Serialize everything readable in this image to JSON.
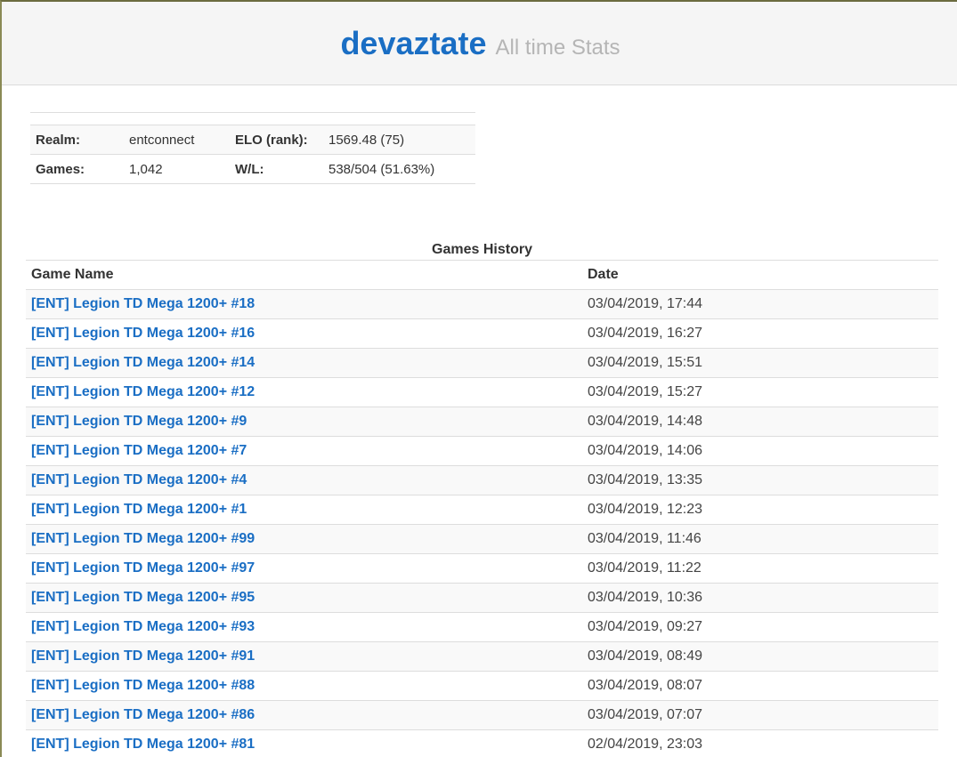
{
  "header": {
    "player_name": "devaztate",
    "subtitle": "All time Stats"
  },
  "stats": {
    "realm_label": "Realm:",
    "realm_value": "entconnect",
    "elo_label": "ELO (rank):",
    "elo_value": "1569.48 (75)",
    "games_label": "Games:",
    "games_value": "1,042",
    "wl_label": "W/L:",
    "wl_value": "538/504 (51.63%)"
  },
  "history": {
    "caption": "Games History",
    "columns": {
      "name": "Game Name",
      "date": "Date"
    },
    "rows": [
      {
        "name": "[ENT] Legion TD Mega 1200+ #18",
        "date": "03/04/2019, 17:44"
      },
      {
        "name": "[ENT] Legion TD Mega 1200+ #16",
        "date": "03/04/2019, 16:27"
      },
      {
        "name": "[ENT] Legion TD Mega 1200+ #14",
        "date": "03/04/2019, 15:51"
      },
      {
        "name": "[ENT] Legion TD Mega 1200+ #12",
        "date": "03/04/2019, 15:27"
      },
      {
        "name": "[ENT] Legion TD Mega 1200+ #9",
        "date": "03/04/2019, 14:48"
      },
      {
        "name": "[ENT] Legion TD Mega 1200+ #7",
        "date": "03/04/2019, 14:06"
      },
      {
        "name": "[ENT] Legion TD Mega 1200+ #4",
        "date": "03/04/2019, 13:35"
      },
      {
        "name": "[ENT] Legion TD Mega 1200+ #1",
        "date": "03/04/2019, 12:23"
      },
      {
        "name": "[ENT] Legion TD Mega 1200+ #99",
        "date": "03/04/2019, 11:46"
      },
      {
        "name": "[ENT] Legion TD Mega 1200+ #97",
        "date": "03/04/2019, 11:22"
      },
      {
        "name": "[ENT] Legion TD Mega 1200+ #95",
        "date": "03/04/2019, 10:36"
      },
      {
        "name": "[ENT] Legion TD Mega 1200+ #93",
        "date": "03/04/2019, 09:27"
      },
      {
        "name": "[ENT] Legion TD Mega 1200+ #91",
        "date": "03/04/2019, 08:49"
      },
      {
        "name": "[ENT] Legion TD Mega 1200+ #88",
        "date": "03/04/2019, 08:07"
      },
      {
        "name": "[ENT] Legion TD Mega 1200+ #86",
        "date": "03/04/2019, 07:07"
      },
      {
        "name": "[ENT] Legion TD Mega 1200+ #81",
        "date": "02/04/2019, 23:03"
      }
    ]
  },
  "colors": {
    "link": "#1a6ec4",
    "subtitle": "#b5b5b5",
    "header_bg": "#f5f5f5",
    "row_stripe": "#f9f9f9"
  }
}
